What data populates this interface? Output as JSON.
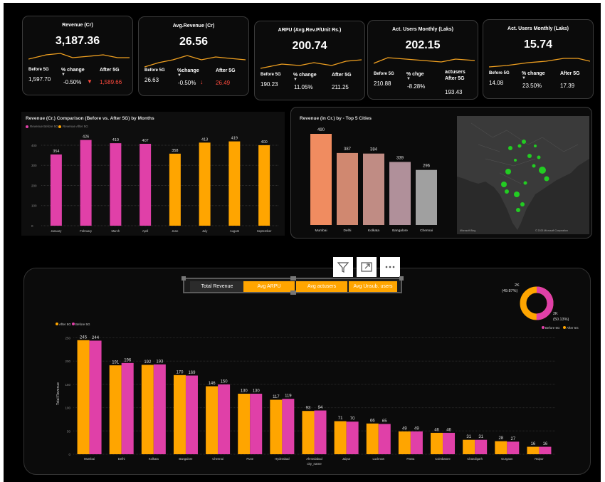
{
  "kpis": [
    {
      "title": "Revenue (Cr)",
      "value": "3,187.36",
      "before_label": "Before 5G",
      "before_value": "1,597.70",
      "change_label": "% change",
      "change_value": "-0.50%",
      "change_icon": "down-triangle-icon",
      "after_label": "After 5G",
      "after_value": "1,589.66"
    },
    {
      "title": "Avg.Revenue (Cr)",
      "value": "26.56",
      "before_label": "Before 5G",
      "before_value": "26.63",
      "change_label": "%change",
      "change_value": "-0.50%",
      "change_icon": "down-arrow-icon",
      "after_label": "After 5G",
      "after_value": "26.49"
    },
    {
      "title": "ARPU (Avg.Rev.P/Unit Rs.)",
      "value": "200.74",
      "before_label": "Before 5G",
      "before_value": "190.23",
      "change_label": "% change",
      "change_value": "11.05%",
      "after_label": "After 5G",
      "after_value": "211.25"
    },
    {
      "title": "Act. Users Monthly (Laks)",
      "value": "202.15",
      "before_label": "Before 5G",
      "before_value": "210.88",
      "change_label": "% chge",
      "change_value": "-8.28%",
      "after_label": "actusers After 5G",
      "after_value": "193.43"
    },
    {
      "title": "Act. Users Monthly (Laks)",
      "value": "15.74",
      "before_label": "Before 5G",
      "before_value": "14.08",
      "change_label": "% change",
      "change_value": "23.50%",
      "after_label": "After 5G",
      "after_value": "17.39"
    }
  ],
  "colors": {
    "before": "#e040a8",
    "after": "#ffa500",
    "red": "#ff4a3d",
    "kpi_line": "#f0a020",
    "map_dot": "#22cc22"
  },
  "monthly": {
    "title": "Revenue (Cr.) Comparison (Before vs. After 5G) by Months",
    "legend_before": "Revenue Before 5G",
    "legend_after": "Revenue After 5G"
  },
  "cities_top5": {
    "title": "Revenue (in Cr.) by - Top 5 Cities",
    "map_attribution": "© 2023 Microsoft Corporation",
    "map_brand": "Microsoft Bing"
  },
  "slicer": {
    "buttons": [
      "Total Revenue",
      "Avg ARPU",
      "Avg actusers",
      "Avg Unsub. users"
    ]
  },
  "donut": {
    "label_top": "2K",
    "pct_top": "(49.87%)",
    "label_bottom": "2K",
    "pct_bottom": "(50.13%)",
    "legend_before": "Before 5G",
    "legend_after": "After 5G"
  },
  "city_chart": {
    "legend_after": "After 5G",
    "legend_before": "Before 5G",
    "ylabel": "Total Revenue",
    "xlabel": "city_name"
  },
  "chart_data": [
    {
      "type": "bar",
      "title": "Revenue (Cr.) Comparison (Before vs. After 5G) by Months",
      "categories": [
        "January",
        "February",
        "March",
        "April",
        "June",
        "July",
        "August",
        "September"
      ],
      "series": [
        {
          "name": "Revenue Before 5G",
          "values": [
            354,
            426,
            410,
            407,
            null,
            null,
            null,
            null
          ]
        },
        {
          "name": "Revenue After 5G",
          "values": [
            null,
            null,
            null,
            null,
            358,
            413,
            419,
            400
          ]
        }
      ],
      "yticks": [
        0,
        100,
        200,
        300,
        400
      ],
      "ylim": [
        0,
        460
      ]
    },
    {
      "type": "bar",
      "title": "Revenue (in Cr.) by - Top 5 Cities",
      "categories": [
        "Mumbai",
        "Delhi",
        "Kolkata",
        "Bangalore",
        "Chennai"
      ],
      "values": [
        490,
        387,
        384,
        339,
        296
      ]
    },
    {
      "type": "pie",
      "slices": [
        {
          "name": "Before 5G",
          "label": "2K",
          "pct": 50.13
        },
        {
          "name": "After 5G",
          "label": "2K",
          "pct": 49.87
        }
      ]
    },
    {
      "type": "bar",
      "xlabel": "city_name",
      "ylabel": "Total Revenue",
      "categories": [
        "Mumbai",
        "Delhi",
        "Kolkata",
        "Bangalore",
        "Chennai",
        "Pune",
        "Hyderabad",
        "Ahmedabad",
        "Jaipur",
        "Lucknow",
        "Patna",
        "Coimbatore",
        "Chandigarh",
        "Gurgaon",
        "Raipur"
      ],
      "series": [
        {
          "name": "After 5G",
          "values": [
            245,
            191,
            192,
            170,
            146,
            130,
            117,
            93,
            71,
            66,
            49,
            46,
            31,
            28,
            16
          ]
        },
        {
          "name": "Before 5G",
          "values": [
            244,
            196,
            193,
            169,
            150,
            130,
            119,
            94,
            70,
            65,
            49,
            46,
            31,
            27,
            16
          ]
        }
      ],
      "yticks": [
        0,
        50,
        100,
        150,
        200,
        250
      ],
      "ylim": [
        0,
        260
      ]
    }
  ]
}
